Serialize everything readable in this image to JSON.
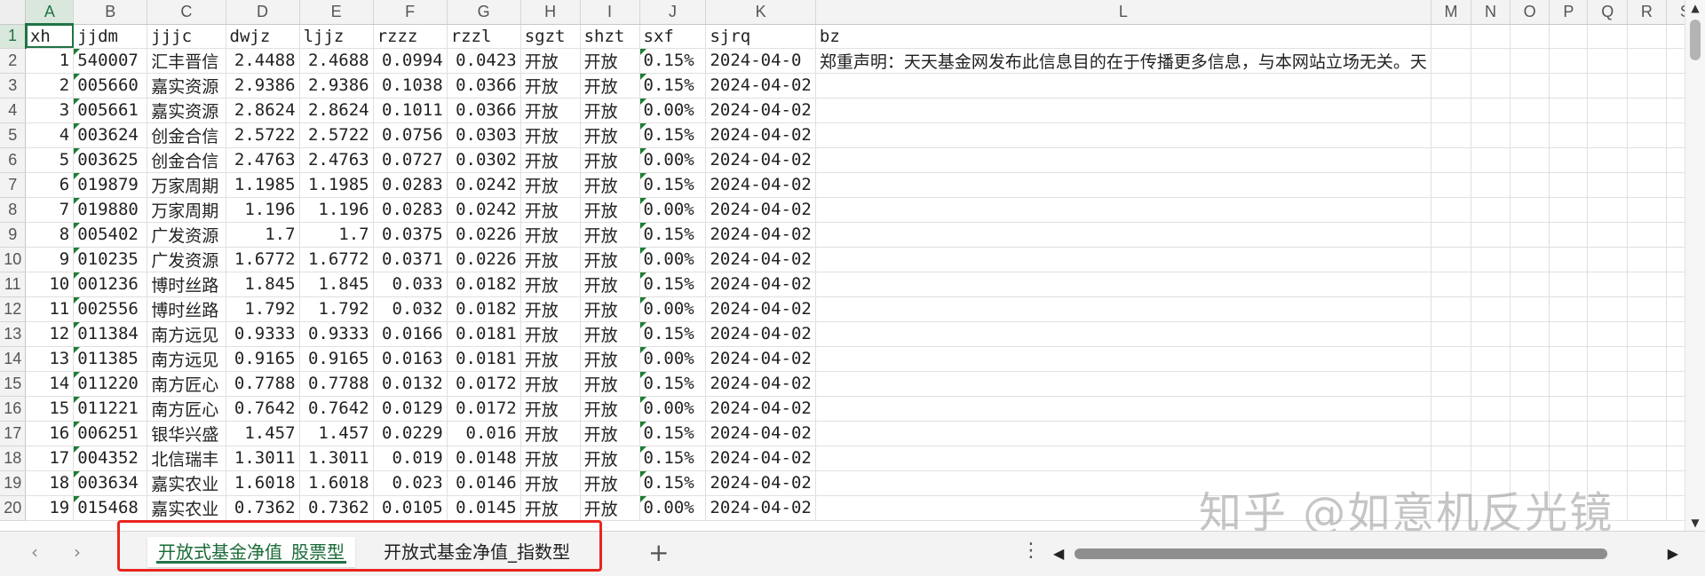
{
  "columns": [
    "A",
    "B",
    "C",
    "D",
    "E",
    "F",
    "G",
    "H",
    "I",
    "J",
    "K",
    "L",
    "M",
    "N",
    "O",
    "P",
    "Q",
    "R",
    "S"
  ],
  "header_row": [
    "xh",
    "jjdm",
    "jjjc",
    "dwjz",
    "ljjz",
    "rzzz",
    "rzzl",
    "sgzt",
    "shzt",
    "sxf",
    "sjrq",
    "bz"
  ],
  "rows": [
    {
      "n": "1"
    },
    {
      "n": "2",
      "xh": "1",
      "jjdm": "540007",
      "jjjc": "汇丰晋信",
      "dwjz": "2.4488",
      "ljjz": "2.4688",
      "rzzz": "0.0994",
      "rzzl": "0.0423",
      "sgzt": "开放",
      "shzt": "开放",
      "sxf": "0.15%",
      "sjrq": "2024-04-0",
      "bz": "郑重声明：天天基金网发布此信息目的在于传播更多信息，与本网站立场无关。天"
    },
    {
      "n": "3",
      "xh": "2",
      "jjdm": "005660",
      "jjjc": "嘉实资源",
      "dwjz": "2.9386",
      "ljjz": "2.9386",
      "rzzz": "0.1038",
      "rzzl": "0.0366",
      "sgzt": "开放",
      "shzt": "开放",
      "sxf": "0.15%",
      "sjrq": "2024-04-02"
    },
    {
      "n": "4",
      "xh": "3",
      "jjdm": "005661",
      "jjjc": "嘉实资源",
      "dwjz": "2.8624",
      "ljjz": "2.8624",
      "rzzz": "0.1011",
      "rzzl": "0.0366",
      "sgzt": "开放",
      "shzt": "开放",
      "sxf": "0.00%",
      "sjrq": "2024-04-02"
    },
    {
      "n": "5",
      "xh": "4",
      "jjdm": "003624",
      "jjjc": "创金合信",
      "dwjz": "2.5722",
      "ljjz": "2.5722",
      "rzzz": "0.0756",
      "rzzl": "0.0303",
      "sgzt": "开放",
      "shzt": "开放",
      "sxf": "0.15%",
      "sjrq": "2024-04-02"
    },
    {
      "n": "6",
      "xh": "5",
      "jjdm": "003625",
      "jjjc": "创金合信",
      "dwjz": "2.4763",
      "ljjz": "2.4763",
      "rzzz": "0.0727",
      "rzzl": "0.0302",
      "sgzt": "开放",
      "shzt": "开放",
      "sxf": "0.00%",
      "sjrq": "2024-04-02"
    },
    {
      "n": "7",
      "xh": "6",
      "jjdm": "019879",
      "jjjc": "万家周期",
      "dwjz": "1.1985",
      "ljjz": "1.1985",
      "rzzz": "0.0283",
      "rzzl": "0.0242",
      "sgzt": "开放",
      "shzt": "开放",
      "sxf": "0.15%",
      "sjrq": "2024-04-02"
    },
    {
      "n": "8",
      "xh": "7",
      "jjdm": "019880",
      "jjjc": "万家周期",
      "dwjz": "1.196",
      "ljjz": "1.196",
      "rzzz": "0.0283",
      "rzzl": "0.0242",
      "sgzt": "开放",
      "shzt": "开放",
      "sxf": "0.00%",
      "sjrq": "2024-04-02"
    },
    {
      "n": "9",
      "xh": "8",
      "jjdm": "005402",
      "jjjc": "广发资源",
      "dwjz": "1.7",
      "ljjz": "1.7",
      "rzzz": "0.0375",
      "rzzl": "0.0226",
      "sgzt": "开放",
      "shzt": "开放",
      "sxf": "0.15%",
      "sjrq": "2024-04-02"
    },
    {
      "n": "10",
      "xh": "9",
      "jjdm": "010235",
      "jjjc": "广发资源",
      "dwjz": "1.6772",
      "ljjz": "1.6772",
      "rzzz": "0.0371",
      "rzzl": "0.0226",
      "sgzt": "开放",
      "shzt": "开放",
      "sxf": "0.00%",
      "sjrq": "2024-04-02"
    },
    {
      "n": "11",
      "xh": "10",
      "jjdm": "001236",
      "jjjc": "博时丝路",
      "dwjz": "1.845",
      "ljjz": "1.845",
      "rzzz": "0.033",
      "rzzl": "0.0182",
      "sgzt": "开放",
      "shzt": "开放",
      "sxf": "0.15%",
      "sjrq": "2024-04-02"
    },
    {
      "n": "12",
      "xh": "11",
      "jjdm": "002556",
      "jjjc": "博时丝路",
      "dwjz": "1.792",
      "ljjz": "1.792",
      "rzzz": "0.032",
      "rzzl": "0.0182",
      "sgzt": "开放",
      "shzt": "开放",
      "sxf": "0.00%",
      "sjrq": "2024-04-02"
    },
    {
      "n": "13",
      "xh": "12",
      "jjdm": "011384",
      "jjjc": "南方远见",
      "dwjz": "0.9333",
      "ljjz": "0.9333",
      "rzzz": "0.0166",
      "rzzl": "0.0181",
      "sgzt": "开放",
      "shzt": "开放",
      "sxf": "0.15%",
      "sjrq": "2024-04-02"
    },
    {
      "n": "14",
      "xh": "13",
      "jjdm": "011385",
      "jjjc": "南方远见",
      "dwjz": "0.9165",
      "ljjz": "0.9165",
      "rzzz": "0.0163",
      "rzzl": "0.0181",
      "sgzt": "开放",
      "shzt": "开放",
      "sxf": "0.00%",
      "sjrq": "2024-04-02"
    },
    {
      "n": "15",
      "xh": "14",
      "jjdm": "011220",
      "jjjc": "南方匠心",
      "dwjz": "0.7788",
      "ljjz": "0.7788",
      "rzzz": "0.0132",
      "rzzl": "0.0172",
      "sgzt": "开放",
      "shzt": "开放",
      "sxf": "0.15%",
      "sjrq": "2024-04-02"
    },
    {
      "n": "16",
      "xh": "15",
      "jjdm": "011221",
      "jjjc": "南方匠心",
      "dwjz": "0.7642",
      "ljjz": "0.7642",
      "rzzz": "0.0129",
      "rzzl": "0.0172",
      "sgzt": "开放",
      "shzt": "开放",
      "sxf": "0.00%",
      "sjrq": "2024-04-02"
    },
    {
      "n": "17",
      "xh": "16",
      "jjdm": "006251",
      "jjjc": "银华兴盛",
      "dwjz": "1.457",
      "ljjz": "1.457",
      "rzzz": "0.0229",
      "rzzl": "0.016",
      "sgzt": "开放",
      "shzt": "开放",
      "sxf": "0.15%",
      "sjrq": "2024-04-02"
    },
    {
      "n": "18",
      "xh": "17",
      "jjdm": "004352",
      "jjjc": "北信瑞丰",
      "dwjz": "1.3011",
      "ljjz": "1.3011",
      "rzzz": "0.019",
      "rzzl": "0.0148",
      "sgzt": "开放",
      "shzt": "开放",
      "sxf": "0.15%",
      "sjrq": "2024-04-02"
    },
    {
      "n": "19",
      "xh": "18",
      "jjdm": "003634",
      "jjjc": "嘉实农业",
      "dwjz": "1.6018",
      "ljjz": "1.6018",
      "rzzz": "0.023",
      "rzzl": "0.0146",
      "sgzt": "开放",
      "shzt": "开放",
      "sxf": "0.15%",
      "sjrq": "2024-04-02"
    },
    {
      "n": "20",
      "xh": "19",
      "jjdm": "015468",
      "jjjc": "嘉实农业",
      "dwjz": "0.7362",
      "ljjz": "0.7362",
      "rzzz": "0.0105",
      "rzzl": "0.0145",
      "sgzt": "开放",
      "shzt": "开放",
      "sxf": "0.00%",
      "sjrq": "2024-04-02"
    }
  ],
  "tabs": [
    {
      "label": "开放式基金净值_股票型",
      "active": true
    },
    {
      "label": "开放式基金净值_指数型",
      "active": false
    }
  ],
  "tabbar": {
    "prev": "‹",
    "next": "›",
    "add": "+",
    "more": "⋮"
  },
  "watermark": "知乎 @如意机反光镜"
}
